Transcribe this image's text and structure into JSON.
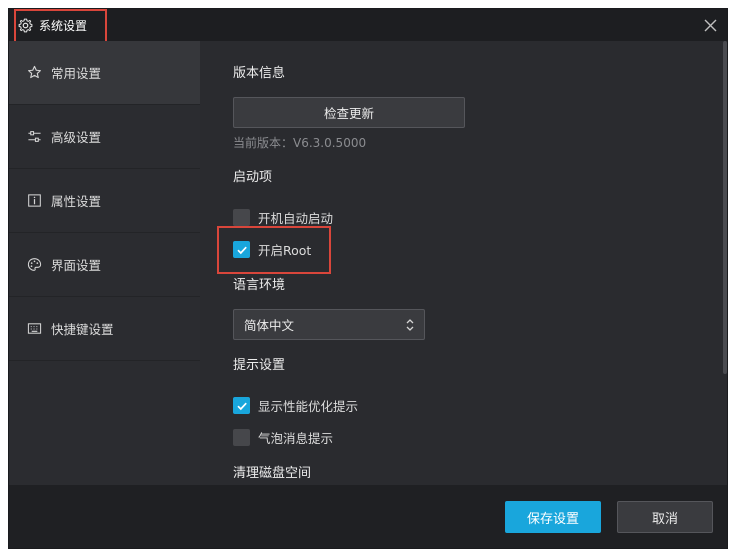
{
  "window": {
    "title": "系统设置",
    "title_icon": "gear-icon",
    "close_icon": "close-icon"
  },
  "sidebar": {
    "items": [
      {
        "label": "常用设置",
        "icon": "star-icon",
        "active": true
      },
      {
        "label": "高级设置",
        "icon": "sliders-icon",
        "active": false
      },
      {
        "label": "属性设置",
        "icon": "info-icon",
        "active": false
      },
      {
        "label": "界面设置",
        "icon": "palette-icon",
        "active": false
      },
      {
        "label": "快捷键设置",
        "icon": "keyboard-icon",
        "active": false
      }
    ]
  },
  "content": {
    "version": {
      "title": "版本信息",
      "check_update_label": "检查更新",
      "current_version": "当前版本：V6.3.0.5000"
    },
    "startup": {
      "title": "启动项",
      "options": [
        {
          "label": "开机自动启动",
          "checked": false
        },
        {
          "label": "开启Root",
          "checked": true
        }
      ]
    },
    "language": {
      "title": "语言环境",
      "selected": "简体中文"
    },
    "tips": {
      "title": "提示设置",
      "options": [
        {
          "label": "显示性能优化提示",
          "checked": true
        },
        {
          "label": "气泡消息提示",
          "checked": false
        }
      ]
    },
    "disk": {
      "title": "清理磁盘空间"
    }
  },
  "footer": {
    "save_label": "保存设置",
    "cancel_label": "取消"
  },
  "colors": {
    "accent": "#19a6dc",
    "highlight": "#d9463b",
    "background": "#2a2b2f"
  }
}
